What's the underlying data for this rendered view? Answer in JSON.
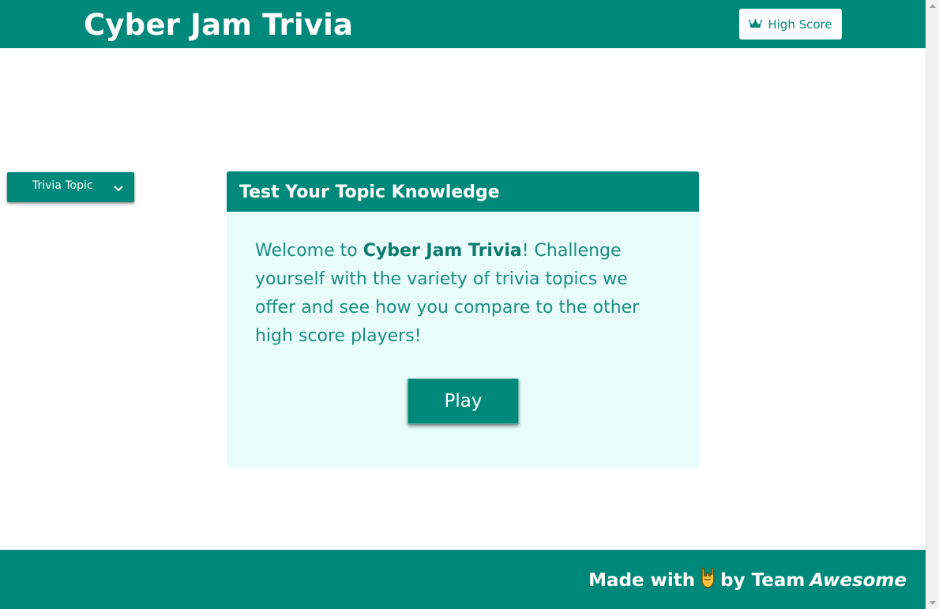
{
  "header": {
    "brand": "Cyber Jam Trivia",
    "high_score_label": "High Score",
    "high_score_icon": "crown-icon"
  },
  "dropdown": {
    "label": "Trivia Topic",
    "icon": "chevron-down-icon"
  },
  "card": {
    "title": "Test Your Topic Knowledge",
    "text_before": "Welcome to ",
    "text_bold": "Cyber Jam Trivia",
    "text_after": "! Challenge yourself with the variety of trivia topics we offer and see how you compare to the other high score players!",
    "play_label": "Play"
  },
  "footer": {
    "made_with": "Made with",
    "icon": "rock-hand-emoji-icon",
    "by_team": "by Team",
    "team_name": "Awesome"
  },
  "colors": {
    "primary": "#00897b",
    "card_bg": "#e8fdfb",
    "text_teal": "#1a8d80"
  }
}
